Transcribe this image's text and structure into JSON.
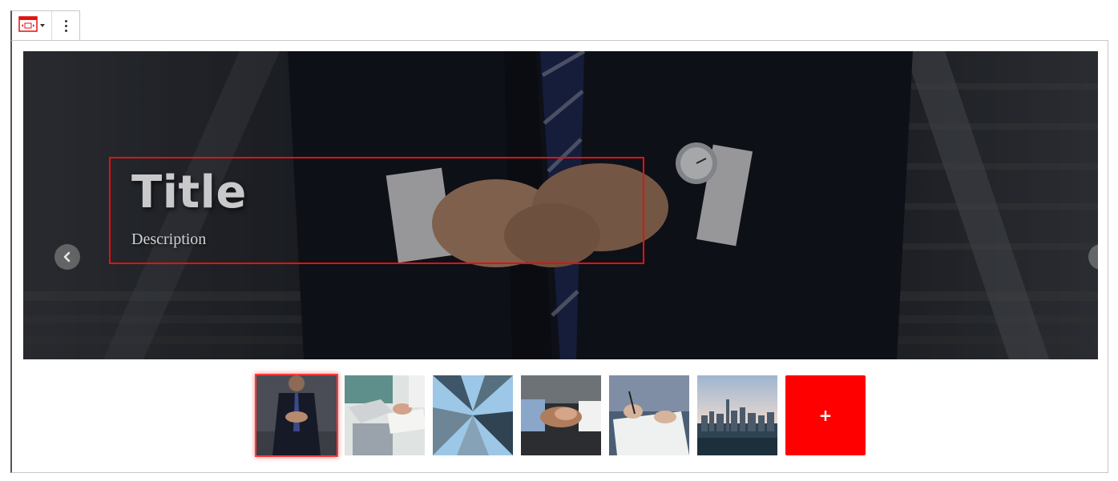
{
  "toolbar": {
    "block_icon": "slider-block-icon",
    "caret_icon": "caret-down-icon",
    "more_icon": "vertical-ellipsis-icon"
  },
  "slide": {
    "title": "Title",
    "description": "Description",
    "caption_border_color": "#e31111"
  },
  "navigation": {
    "prev_icon": "chevron-left-icon",
    "next_icon": "chevron-right-icon"
  },
  "pagination": {
    "count": 6,
    "active_index": 0,
    "active_color": "#ff1a1a"
  },
  "thumbnails": [
    {
      "subject": "businessman-suit-thumbnail",
      "selected": true
    },
    {
      "subject": "laptop-paperwork-thumbnail",
      "selected": false
    },
    {
      "subject": "skyscrapers-upward-thumbnail",
      "selected": false
    },
    {
      "subject": "handshake-thumbnail",
      "selected": false
    },
    {
      "subject": "signing-document-thumbnail",
      "selected": false
    },
    {
      "subject": "city-skyline-thumbnail",
      "selected": false
    }
  ],
  "add_button": {
    "label": "+",
    "color": "#ff0000"
  }
}
